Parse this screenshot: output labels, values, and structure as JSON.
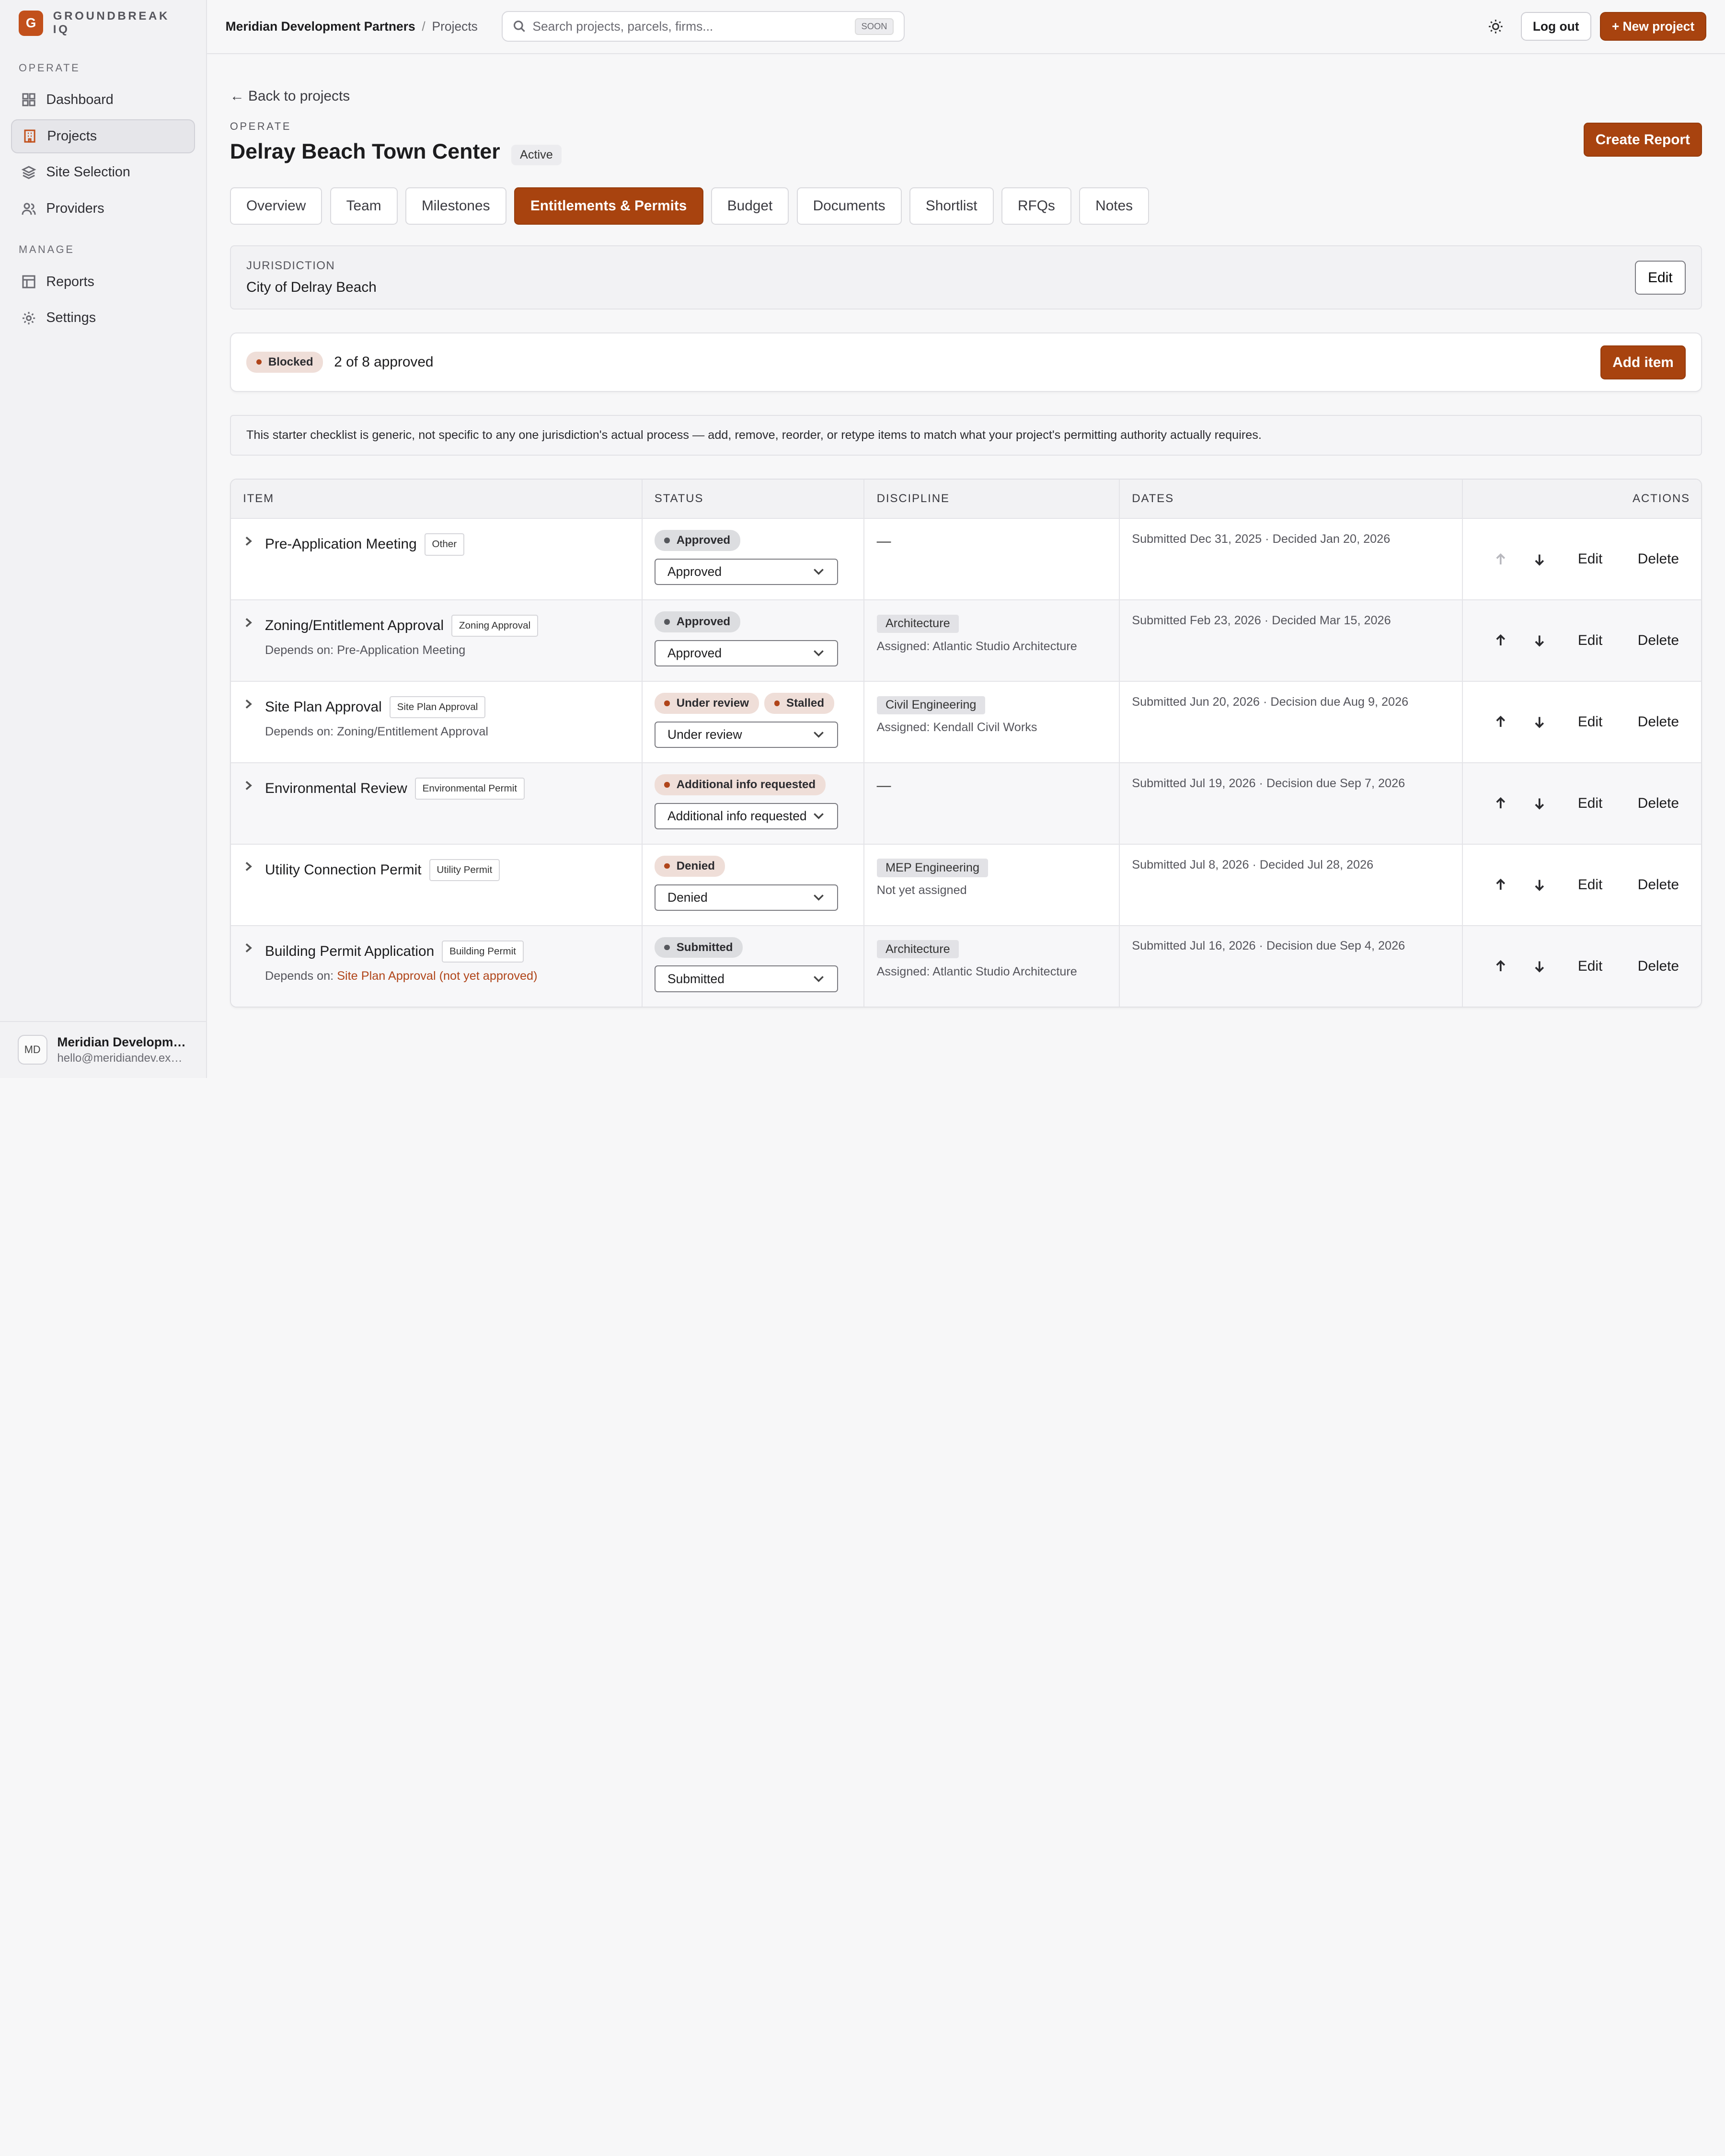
{
  "brand": {
    "initial": "G",
    "name": "GROUNDBREAK IQ",
    "accent": "#c2501b"
  },
  "sidebar": {
    "sections": [
      {
        "heading": "OPERATE",
        "items": [
          {
            "label": "Dashboard",
            "icon": "grid-icon"
          },
          {
            "label": "Projects",
            "icon": "building-icon",
            "active": true
          },
          {
            "label": "Site Selection",
            "icon": "layers-icon"
          },
          {
            "label": "Providers",
            "icon": "users-icon"
          }
        ]
      },
      {
        "heading": "MANAGE",
        "items": [
          {
            "label": "Reports",
            "icon": "table-icon"
          },
          {
            "label": "Settings",
            "icon": "gear-icon"
          }
        ]
      }
    ],
    "user": {
      "initials": "MD",
      "name": "Meridian Development Partners",
      "email": "hello@meridiandev.example"
    }
  },
  "topbar": {
    "breadcrumb_firm": "Meridian Development Partners",
    "breadcrumb_sep": "/",
    "breadcrumb_page": "Projects",
    "search_placeholder": "Search projects, parcels, firms...",
    "search_badge": "SOON",
    "logout_label": "Log out",
    "new_project_label": "+ New project"
  },
  "page": {
    "back_label": "← Back to projects",
    "eyebrow": "OPERATE",
    "title": "Delray Beach Town Center",
    "status": "Active",
    "create_report_label": "Create Report",
    "tabs": [
      "Overview",
      "Team",
      "Milestones",
      "Entitlements & Permits",
      "Budget",
      "Documents",
      "Shortlist",
      "RFQs",
      "Notes"
    ],
    "active_tab": "Entitlements & Permits"
  },
  "jurisdiction": {
    "label": "JURISDICTION",
    "value": "City of Delray Beach",
    "edit_label": "Edit"
  },
  "summary": {
    "badge": "Blocked",
    "text": "2 of 8 approved",
    "add_label": "Add item"
  },
  "notice": "This starter checklist is generic, not specific to any one jurisdiction's actual process — add, remove, reorder, or retype items to match what your project's permitting authority actually requires.",
  "table": {
    "columns": [
      "ITEM",
      "STATUS",
      "DISCIPLINE",
      "DATES",
      "ACTIONS"
    ],
    "actions": {
      "edit": "Edit",
      "delete": "Delete"
    },
    "rows": [
      {
        "name": "Pre-Application Meeting",
        "type": "Other",
        "depends": "",
        "depends_prefix": "",
        "depends_warn": "",
        "badges": [
          {
            "label": "Approved",
            "tone": "gray"
          }
        ],
        "status": "Approved",
        "discipline": "",
        "assigned": "",
        "empty_discipline": "—",
        "dates": "Submitted Dec 31, 2025 · Decided Jan 20, 2026",
        "up_disabled": true
      },
      {
        "name": "Zoning/Entitlement Approval",
        "type": "Zoning Approval",
        "depends": "Depends on: Pre-Application Meeting",
        "depends_prefix": "",
        "depends_warn": "",
        "badges": [
          {
            "label": "Approved",
            "tone": "gray"
          }
        ],
        "status": "Approved",
        "discipline": "Architecture",
        "assigned": "Assigned: Atlantic Studio Architecture",
        "empty_discipline": "",
        "dates": "Submitted Feb 23, 2026 · Decided Mar 15, 2026",
        "up_disabled": false
      },
      {
        "name": "Site Plan Approval",
        "type": "Site Plan Approval",
        "depends": "Depends on: Zoning/Entitlement Approval",
        "depends_prefix": "",
        "depends_warn": "",
        "badges": [
          {
            "label": "Under review",
            "tone": "red"
          },
          {
            "label": "Stalled",
            "tone": "red"
          }
        ],
        "status": "Under review",
        "discipline": "Civil Engineering",
        "assigned": "Assigned: Kendall Civil Works",
        "empty_discipline": "",
        "dates": "Submitted Jun 20, 2026 · Decision due Aug 9, 2026",
        "up_disabled": false
      },
      {
        "name": "Environmental Review",
        "type": "Environmental Permit",
        "depends": "",
        "depends_prefix": "",
        "depends_warn": "",
        "badges": [
          {
            "label": "Additional info requested",
            "tone": "red"
          }
        ],
        "status": "Additional info requested",
        "discipline": "",
        "assigned": "",
        "empty_discipline": "—",
        "dates": "Submitted Jul 19, 2026 · Decision due Sep 7, 2026",
        "up_disabled": false
      },
      {
        "name": "Utility Connection Permit",
        "type": "Utility Permit",
        "depends": "",
        "depends_prefix": "",
        "depends_warn": "",
        "badges": [
          {
            "label": "Denied",
            "tone": "red"
          }
        ],
        "status": "Denied",
        "discipline": "MEP Engineering",
        "assigned": "Not yet assigned",
        "empty_discipline": "",
        "dates": "Submitted Jul 8, 2026 · Decided Jul 28, 2026",
        "up_disabled": false
      },
      {
        "name": "Building Permit Application",
        "type": "Building Permit",
        "depends": "",
        "depends_prefix": "Depends on: ",
        "depends_warn": "Site Plan Approval (not yet approved)",
        "badges": [
          {
            "label": "Submitted",
            "tone": "gray"
          }
        ],
        "status": "Submitted",
        "discipline": "Architecture",
        "assigned": "Assigned: Atlantic Studio Architecture",
        "empty_discipline": "",
        "dates": "Submitted Jul 16, 2026 · Decision due Sep 4, 2026",
        "up_disabled": false
      }
    ]
  }
}
